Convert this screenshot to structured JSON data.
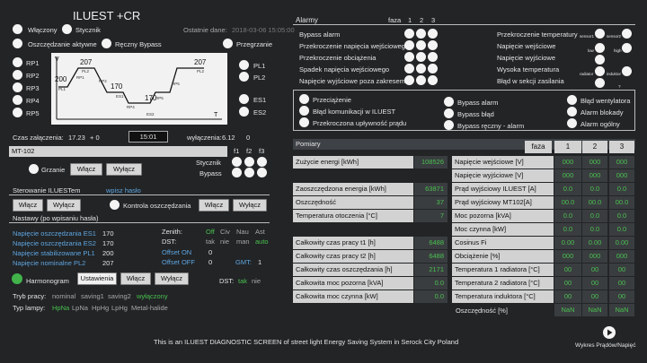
{
  "header": {
    "title": "ILUEST +CR",
    "last_data_label": "Ostatnie dane:",
    "last_data_value": "2018-03-06 15:05:00",
    "wlaczony": "Włączony",
    "stycznik": "Stycznik",
    "oszczedzanie": "Oszczędzanie aktywne",
    "reczny_bypass": "Ręczny Bypass",
    "przegrzanie": "Przegrzanie"
  },
  "chart": {
    "rp_labels": [
      "RP1",
      "RP2",
      "RP3",
      "RP4",
      "RP5"
    ],
    "pl_labels": [
      "PL1",
      "PL2"
    ],
    "es_labels": [
      "ES1",
      "ES2"
    ],
    "v_axis": "V",
    "t_axis": "T",
    "values": [
      "200",
      "207",
      "170",
      "170",
      "207"
    ],
    "seg_labels": [
      "PL1",
      "RP1",
      "PL2",
      "RP2",
      "ES1",
      "RP4",
      "ES2",
      "RP5",
      "RP5",
      "PL2"
    ]
  },
  "times": {
    "zal_label": "Czas załączenia:",
    "zal_value": "17.23",
    "zal_offset": "+ 0",
    "current": "15:01",
    "wyl_label": "wyłączenia:",
    "wyl_value": "6.12",
    "wyl_offset": "0"
  },
  "mt": {
    "title": "MT-102",
    "grzanie": "Grzanie",
    "wlacz": "Włącz",
    "wylacz": "Wyłącz",
    "f_headers": [
      "f1",
      "f2",
      "f3"
    ],
    "stycznik": "Stycznik",
    "bypass": "Bypass"
  },
  "control": {
    "sterowanie_label": "Sterowanie ILUESTem",
    "password_link": "wpisz hasło",
    "kontrola_label": "Kontrola oszczędzania",
    "wlacz": "Włącz",
    "wylacz": "Wyłącz",
    "nastawy_label": "Nastawy (po wpisaniu hasła)"
  },
  "settings": {
    "rows": [
      {
        "label": "Napięcie oszczędzania ES1",
        "value": "170"
      },
      {
        "label": "Napięcie oszczędzania ES2",
        "value": "170"
      },
      {
        "label": "Napięcie stabilizowane PL1",
        "value": "200"
      },
      {
        "label": "Napięcie nominalne PL2",
        "value": "207"
      }
    ],
    "zenith_label": "Zenith:",
    "zenith_opts": [
      "Off",
      "Civ",
      "Nau",
      "Ast"
    ],
    "dst_label": "DST:",
    "dst_opts": [
      "tak",
      "nie",
      "man",
      "auto"
    ],
    "offset_on_label": "Offset ON",
    "offset_on_value": "0",
    "offset_off_label": "Offset OFF",
    "offset_off_value": "0",
    "gmt_label": "GMT:",
    "gmt_value": "1",
    "harmonogram": "Harmonogram",
    "ustawienia": "Ustawienia",
    "wlacz": "Włącz",
    "wylacz": "Wyłącz",
    "dst2_label": "DST:",
    "dst2_opts": [
      "tak",
      "nie"
    ]
  },
  "tryb": {
    "label": "Tryb pracy:",
    "opts": [
      "nominal",
      "saving1",
      "saving2",
      "wyłączony"
    ],
    "lamp_label": "Typ lampy:",
    "lamp_opts": [
      "HpNa",
      "LpNa",
      "HpHg",
      "LpHg",
      "Metal-halide"
    ]
  },
  "alarms": {
    "title": "Alarmy",
    "faza": "faza",
    "phases": [
      "1",
      "2",
      "3"
    ],
    "left": [
      "Bypass alarm",
      "Przekroczenie napięcia wejściowego",
      "Przekroczenie obciążenia",
      "Spadek napięcia wejściowego",
      "Napięcie wyjściowe poza zakresem"
    ],
    "right": [
      "Przekroczenie temperatury",
      "Napięcie wejściowe",
      "Napięcie wyjściowe",
      "Wysoka temperatura",
      "Błąd w sekcji zasilania"
    ],
    "sensor_labels": [
      "sensor1",
      "sensor2",
      "low",
      "high",
      "radiator",
      "induktor",
      "?"
    ],
    "flags_col1": [
      "Przeciążenie",
      "Błąd komunikacji w ILUEST",
      "Przekroczona upływność prądu"
    ],
    "flags_col2": [
      "Bypass alarm",
      "Bypass błąd",
      "Bypass ręczny - alarm"
    ],
    "flags_col3": [
      "Błąd wentylatora",
      "Alarm blokady",
      "Alarm ogólny"
    ]
  },
  "pomiary": {
    "title": "Pomiary",
    "left_rows": [
      {
        "label": "Zużycie energi [kWh]",
        "value": "108526"
      },
      {
        "label": "Zaoszczędzona energia [kWh]",
        "value": "63871"
      },
      {
        "label": "Oszczędność",
        "value": "37"
      },
      {
        "label": "Temperatura otoczenia [°C]",
        "value": "7"
      }
    ],
    "left_rows2": [
      {
        "label": "Całkowity czas pracy t1 [h]",
        "value": "6488"
      },
      {
        "label": "Całkowity czas pracy t2 [h]",
        "value": "6488"
      },
      {
        "label": "Całkowity czas oszczędzania [h]",
        "value": "2171"
      },
      {
        "label": "Całkowita moc pozorna [kVA]",
        "value": "0.0"
      },
      {
        "label": "Całkowita moc czynna [kW]",
        "value": "0.0"
      }
    ],
    "faza_label": "faza",
    "phase_headers": [
      "1",
      "2",
      "3"
    ],
    "right_rows": [
      {
        "label": "Napięcie wejściowe [V]",
        "v": [
          "000",
          "000",
          "000"
        ]
      },
      {
        "label": "Napięcie wyjściowe [V]",
        "v": [
          "000",
          "000",
          "000"
        ]
      },
      {
        "label": "Prąd wyjściowy ILUEST [A]",
        "v": [
          "0.0",
          "0.0",
          "0.0"
        ]
      },
      {
        "label": "Prąd wyjściowy MT102[A]",
        "v": [
          "00.0",
          "00.0",
          "00.0"
        ]
      },
      {
        "label": "Moc pozorna [kVA]",
        "v": [
          "0.0",
          "0.0",
          "0.0"
        ]
      },
      {
        "label": "Moc czynna [kW]",
        "v": [
          "0.0",
          "0.0",
          "0.0"
        ]
      },
      {
        "label": "Cosinus Fi",
        "v": [
          "0.00",
          "0.00",
          "0.00"
        ]
      },
      {
        "label": "Obciążenie [%]",
        "v": [
          "000",
          "000",
          "000"
        ]
      },
      {
        "label": "Temperatura 1 radiatora [°C]",
        "v": [
          "00",
          "00",
          "00"
        ]
      },
      {
        "label": "Temperatura 2 radiatora [°C]",
        "v": [
          "00",
          "00",
          "00"
        ]
      },
      {
        "label": "Temperatura induktora [°C]",
        "v": [
          "00",
          "00",
          "00"
        ]
      }
    ],
    "oszczednosc_label": "Oszczędność [%]",
    "oszczednosc_vals": [
      "NaN",
      "NaN",
      "NaN"
    ]
  },
  "footer": {
    "text": "This is an ILUEST DIAGNOSTIC SCREEN of street light Energy Saving System in Serock City Poland",
    "wykres": "Wykres Prądów/Napięć"
  }
}
